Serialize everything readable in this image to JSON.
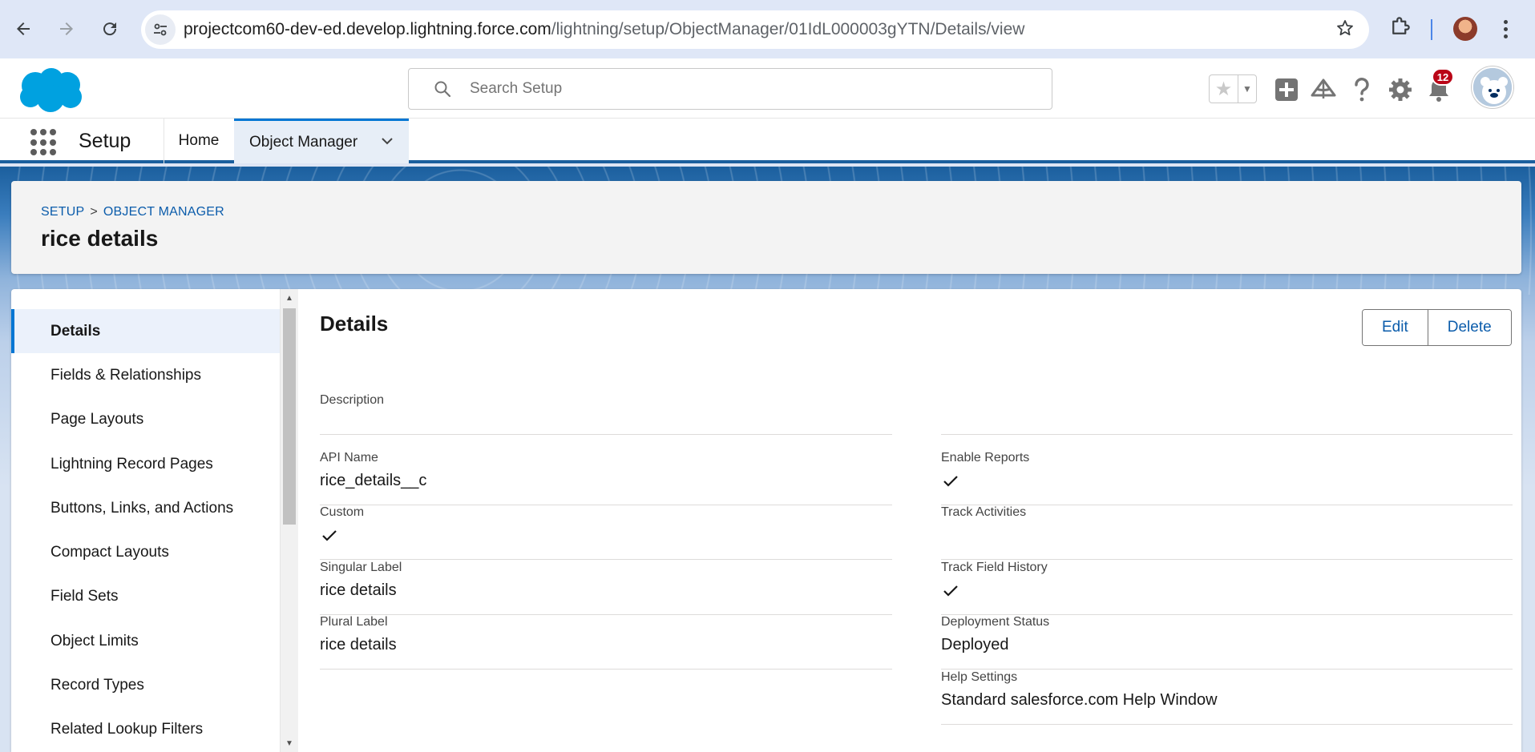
{
  "browser": {
    "url_host": "projectcom60-dev-ed.develop.lightning.force.com",
    "url_path": "/lightning/setup/ObjectManager/01IdL000003gYTN/Details/view"
  },
  "header": {
    "search_placeholder": "Search Setup",
    "notification_count": "12"
  },
  "nav": {
    "app_name": "Setup",
    "home": "Home",
    "object_manager": "Object Manager"
  },
  "page": {
    "breadcrumb": [
      "SETUP",
      "OBJECT MANAGER"
    ],
    "breadcrumb_sep": ">",
    "title": "rice details"
  },
  "sidebar": {
    "items": [
      {
        "label": "Details",
        "active": true
      },
      {
        "label": "Fields & Relationships"
      },
      {
        "label": "Page Layouts"
      },
      {
        "label": "Lightning Record Pages"
      },
      {
        "label": "Buttons, Links, and Actions"
      },
      {
        "label": "Compact Layouts"
      },
      {
        "label": "Field Sets"
      },
      {
        "label": "Object Limits"
      },
      {
        "label": "Record Types"
      },
      {
        "label": "Related Lookup Filters"
      }
    ]
  },
  "details": {
    "title": "Details",
    "edit_label": "Edit",
    "delete_label": "Delete",
    "description_label": "Description",
    "description_value": "",
    "left": [
      {
        "label": "API Name",
        "value": "rice_details__c"
      },
      {
        "label": "Custom",
        "checked": true
      },
      {
        "label": "Singular Label",
        "value": "rice details"
      },
      {
        "label": "Plural Label",
        "value": "rice details"
      }
    ],
    "right": [
      {
        "label": "Enable Reports",
        "checked": true
      },
      {
        "label": "Track Activities",
        "checked": false
      },
      {
        "label": "Track Field History",
        "checked": true
      },
      {
        "label": "Deployment Status",
        "value": "Deployed"
      },
      {
        "label": "Help Settings",
        "value": "Standard salesforce.com Help Window"
      }
    ]
  },
  "colors": {
    "brand": "#0176d3",
    "link": "#0b5cab",
    "nav_accent": "#1b5f9e",
    "badge": "#ba0517"
  },
  "icons": [
    "back-icon",
    "forward-icon",
    "reload-icon",
    "site-info-icon",
    "bookmark-star-icon",
    "extensions-icon",
    "profile-avatar",
    "chrome-menu-icon",
    "salesforce-cloud-logo",
    "search-icon",
    "favorites-star-icon",
    "add-icon",
    "trailhead-icon",
    "help-icon",
    "gear-icon",
    "bell-icon",
    "user-avatar",
    "app-launcher-icon",
    "chevron-down-icon",
    "checkmark-icon"
  ]
}
